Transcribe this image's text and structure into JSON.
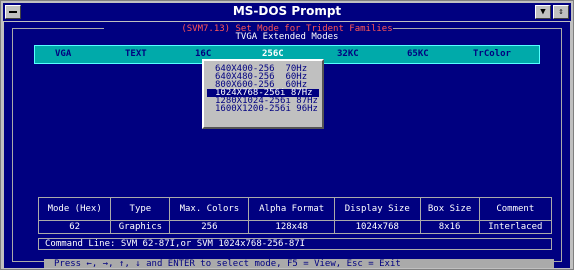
{
  "window": {
    "title": "MS-DOS Prompt"
  },
  "header": {
    "title": "(SVM7.13) Set Mode for Trident Families",
    "subtitle": "TVGA Extended Modes"
  },
  "tabs": [
    {
      "label": "VGA",
      "selected": false
    },
    {
      "label": "TEXT",
      "selected": false
    },
    {
      "label": "16C",
      "selected": false
    },
    {
      "label": "256C",
      "selected": true
    },
    {
      "label": "32KC",
      "selected": false
    },
    {
      "label": "65KC",
      "selected": false
    },
    {
      "label": "TrColor",
      "selected": false
    }
  ],
  "dropdown": {
    "items": [
      {
        "res": "640X400-256",
        "hz": "70Hz",
        "selected": false
      },
      {
        "res": "640X480-256",
        "hz": "60Hz",
        "selected": false
      },
      {
        "res": "800X600-256",
        "hz": "60Hz",
        "selected": false
      },
      {
        "res": "1024X768-256i",
        "hz": "87Hz",
        "selected": true
      },
      {
        "res": "1280X1024-256i",
        "hz": "87Hz",
        "selected": false
      },
      {
        "res": "1600X1200-256i",
        "hz": "96Hz",
        "selected": false
      }
    ]
  },
  "table": {
    "headers": [
      "Mode (Hex)",
      "Type",
      "Max. Colors",
      "Alpha Format",
      "Display Size",
      "Box Size",
      "Comment"
    ],
    "row": [
      "62",
      "Graphics",
      "256",
      "128x48",
      "1024x768",
      "8x16",
      "Interlaced"
    ]
  },
  "command_line": "Command Line: SVM 62-87I,or SVM 1024x768-256-87I",
  "footer": "Press ←, →, ↑, ↓ and ENTER to select mode, F5 = View, Esc = Exit",
  "colors": {
    "dos_bg": "#000080",
    "tab_bg": "#00aaaa",
    "title_red": "#ff5555"
  }
}
